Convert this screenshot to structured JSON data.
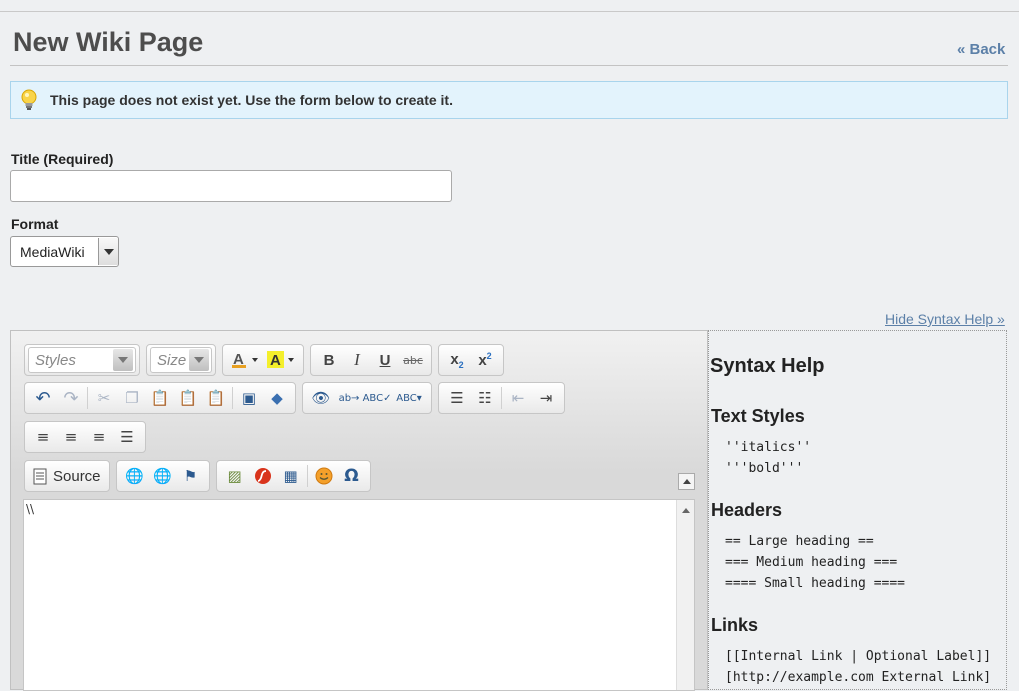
{
  "page": {
    "title": "New Wiki Page",
    "back_link": "« Back"
  },
  "notice": {
    "text": "This page does not exist yet. Use the form below to create it.",
    "icon": "lightbulb-icon"
  },
  "form": {
    "title_label": "Title (Required)",
    "title_value": "",
    "format_label": "Format",
    "format_value": "MediaWiki"
  },
  "hide_syntax_help": "Hide Syntax Help »",
  "editor": {
    "styles_placeholder": "Styles",
    "size_placeholder": "Size",
    "source_label": "Source",
    "content": "\\\\"
  },
  "syntax_help": {
    "heading": "Syntax Help",
    "sections": [
      {
        "title": "Text Styles",
        "lines": [
          "''italics''",
          "'''bold'''"
        ]
      },
      {
        "title": "Headers",
        "lines": [
          "== Large heading ==",
          "=== Medium heading ===",
          "==== Small heading ===="
        ]
      },
      {
        "title": "Links",
        "lines": [
          "[[Internal Link | Optional Label]]",
          "[http://example.com External Link]"
        ]
      }
    ]
  },
  "colors": {
    "notice_bg": "#e3f3fc",
    "link": "#5c80a8",
    "page_bg": "#eef0f2"
  }
}
